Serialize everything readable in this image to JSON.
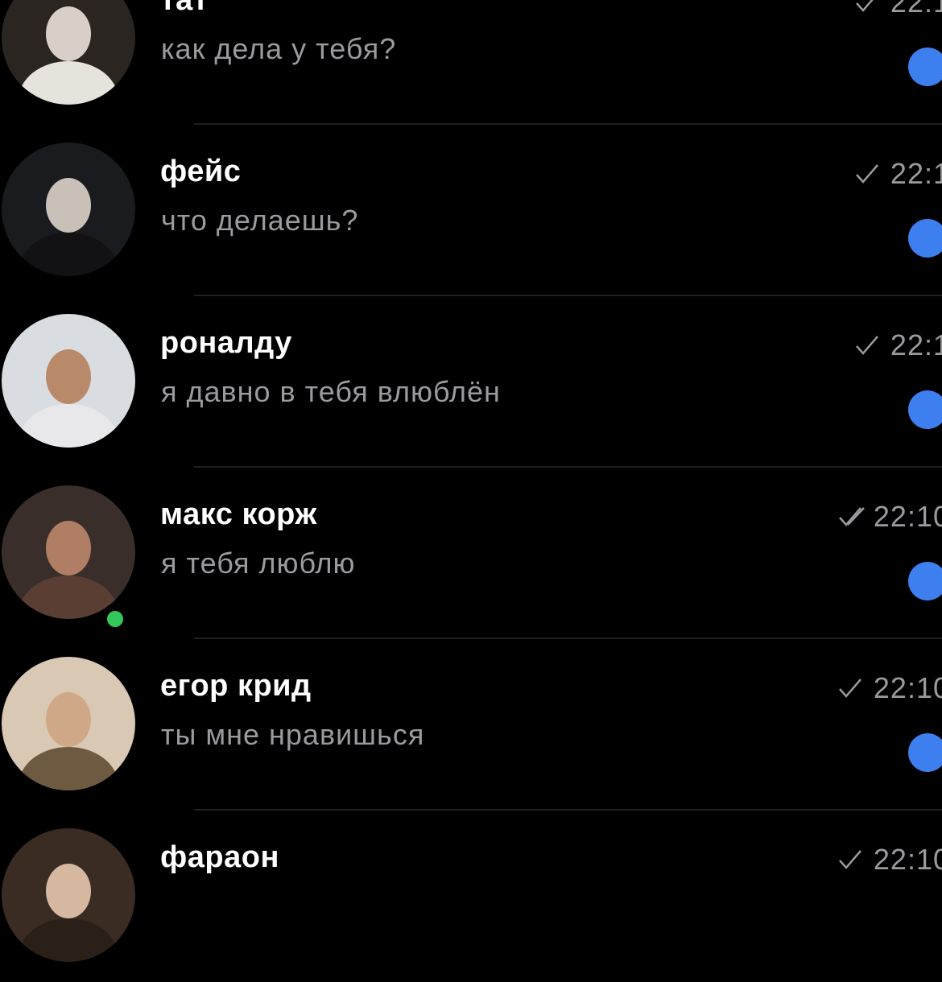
{
  "chats": [
    {
      "name": "тат",
      "preview": "как дела у тебя?",
      "time": "22:1",
      "status": "sent",
      "online": false,
      "unread": true,
      "avatar": {
        "bg": "#2a2520",
        "skin": "#d8d0c8",
        "shirt": "#e6e2dc"
      }
    },
    {
      "name": "фейс",
      "preview": "что делаешь?",
      "time": "22:1",
      "status": "sent",
      "online": false,
      "unread": true,
      "avatar": {
        "bg": "#1a1b1e",
        "skin": "#c9c0b8",
        "shirt": "#121214"
      }
    },
    {
      "name": "роналду",
      "preview": "я давно в тебя влюблён",
      "time": "22:1",
      "status": "sent",
      "online": false,
      "unread": true,
      "avatar": {
        "bg": "#d9dde2",
        "skin": "#b98a6a",
        "shirt": "#e8e8ea"
      }
    },
    {
      "name": "макс корж",
      "preview": "я тебя люблю",
      "time": "22:10",
      "status": "read",
      "online": true,
      "unread": true,
      "avatar": {
        "bg": "#3a2e2a",
        "skin": "#b07e64",
        "shirt": "#5a3e34"
      }
    },
    {
      "name": "егор крид",
      "preview": "ты мне нравишься",
      "time": "22:10",
      "status": "sent",
      "online": false,
      "unread": true,
      "avatar": {
        "bg": "#d8c8b4",
        "skin": "#cfa888",
        "shirt": "#6e5a40"
      }
    },
    {
      "name": "фараон",
      "preview": "",
      "time": "22:10",
      "status": "sent",
      "online": false,
      "unread": false,
      "avatar": {
        "bg": "#3a2c22",
        "skin": "#d6b8a0",
        "shirt": "#2a2018"
      }
    }
  ],
  "colors": {
    "background": "#000000",
    "name": "#ffffff",
    "secondary_text": "#9a9a9f",
    "unread_dot": "#3e7ff0",
    "online_dot": "#34c759",
    "divider": "#1f1f22"
  },
  "icons": {
    "sent": "check-icon",
    "read": "double-check-icon"
  }
}
